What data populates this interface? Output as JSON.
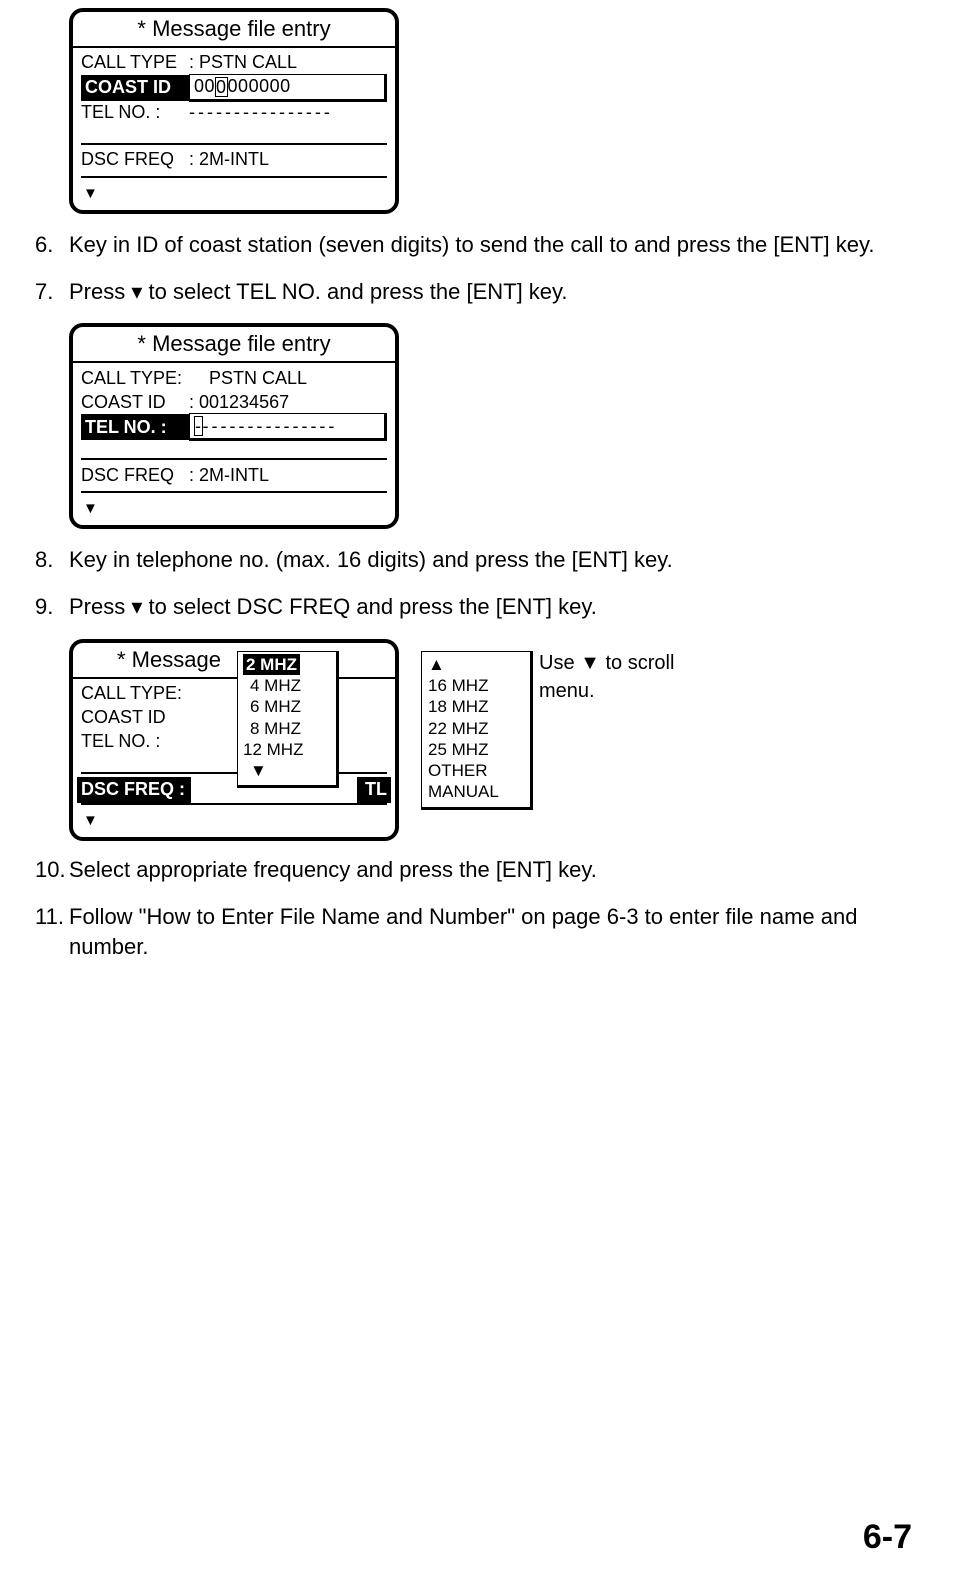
{
  "fig1": {
    "title": "* Message file entry",
    "r1_label": "CALL  TYPE",
    "r1_val": ": PSTN CALL",
    "sel_label": "COAST ID",
    "input_pre": "00",
    "input_cursor": "0",
    "input_post": "000000",
    "r3_label": "TEL NO. :",
    "r3_val": "- - - - - - - - - - - - - - - -",
    "r4_label": "DSC  FREQ",
    "r4_val": ": 2M-INTL",
    "arrow": "▼"
  },
  "step6_num": "6.",
  "step6_text": "Key in ID of coast station (seven digits) to send the call to and press the [ENT] key.",
  "step7_num": "7.",
  "step7_text_a": "Press ",
  "step7_text_b": " to select TEL NO. and press the [ENT] key.",
  "fig2": {
    "title": "* Message file entry",
    "r1_label": "CALL  TYPE:",
    "r1_val": "PSTN CALL",
    "r2_label": "COAST ID",
    "r2_val": ": 001234567",
    "sel_label": "TEL NO. :",
    "input_cursor": "-",
    "input_post": "- - - - - - - - - - - - - - -",
    "r4_label": "DSC  FREQ",
    "r4_val": ": 2M-INTL",
    "arrow": "▼"
  },
  "step8_num": "8.",
  "step8_text": "Key in telephone no. (max. 16 digits) and press the [ENT] key.",
  "step9_num": "9.",
  "step9_text_a": "Press ",
  "step9_text_b": " to select DSC FREQ and press the [ENT] key.",
  "fig3": {
    "title": "* Message",
    "r1_label": "CALL  TYPE:",
    "r2_label": "COAST ID",
    "r3_label": "TEL NO. :",
    "dsc_left": "DSC  FREQ     :",
    "dsc_right": "TL",
    "arrow": "▼",
    "overlay1": {
      "sel": "2 MHZ",
      "i2": "4 MHZ",
      "i3": "6 MHZ",
      "i4": "8 MHZ",
      "i5": "12 MHZ",
      "arrow": "▼"
    },
    "overlay2": {
      "arrow": "▲",
      "i1": "16 MHZ",
      "i2": "18 MHZ",
      "i3": "22 MHZ",
      "i4": "25 MHZ",
      "i5": "OTHER",
      "i6": "MANUAL"
    },
    "scroll_note_a": "Use ",
    "scroll_note_b": " to scroll",
    "scroll_note_c": "menu."
  },
  "step10_num": "10.",
  "step10_text": "Select appropriate frequency and press the [ENT] key.",
  "step11_num": "11.",
  "step11_text": "Follow \"How to Enter File Name and Number\" on page 6-3 to enter file name and number.",
  "page_num": "6-7"
}
